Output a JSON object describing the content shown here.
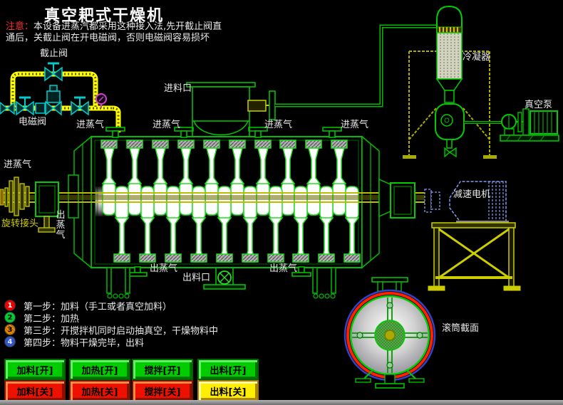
{
  "title": "真空耙式干燥机",
  "warning": {
    "prefix": "注意：",
    "line1": "本设备进蒸汽都采用这种接入法,先开截止阀直",
    "line2": "通后，关截止阀在开电磁阀，否则电磁阀容易损坏"
  },
  "labels": {
    "stop_valve": "截止阀",
    "solenoid_valve": "电磁阀",
    "feed_inlet": "进料口",
    "steam_in": "进蒸气",
    "steam_out": "出蒸气",
    "rotary_joint": "旋转接头",
    "discharge_port": "出料口",
    "condenser": "冷凝器",
    "vacuum_pump": "真空泵",
    "gear_motor": "减速电机",
    "drum_section": "滚筒截面"
  },
  "steps": [
    {
      "num": "1",
      "color": "#ee0000",
      "text": "第一步：加料（手工或者真空加料）"
    },
    {
      "num": "2",
      "color": "#00cc33",
      "text": "第二步：加热"
    },
    {
      "num": "3",
      "color": "#ee8800",
      "text": "第三步：开搅拌机同时启动抽真空，干燥物料中"
    },
    {
      "num": "4",
      "color": "#3355cc",
      "text": "第四步：物料干燥完毕，出料"
    }
  ],
  "buttons": {
    "row_on": [
      {
        "label": "加料[开]",
        "color": "#00cc00"
      },
      {
        "label": "加热[开]",
        "color": "#00cc00"
      },
      {
        "label": "搅拌[开]",
        "color": "#00cc00"
      },
      {
        "label": "出料[开]",
        "color": "#00cc00"
      }
    ],
    "row_off": [
      {
        "label": "加料[关]",
        "color": "#ee1100"
      },
      {
        "label": "加热[关]",
        "color": "#ee1100"
      },
      {
        "label": "搅拌[关]",
        "color": "#ee1100"
      },
      {
        "label": "出料[关]",
        "color": "#ffee00"
      }
    ]
  },
  "colors": {
    "background": "#000000",
    "line_green": "#00cc00",
    "pipe_yellow": "#ffff00",
    "structure_yellow": "#cccc00",
    "valve_cyan": "#00cccc",
    "gauge_magenta": "#cc44cc",
    "motor_dashed_blue": "#8899ee",
    "warning_red": "#ff3333",
    "red_ring": "#ff2200",
    "blue_ring": "#3344cc"
  }
}
